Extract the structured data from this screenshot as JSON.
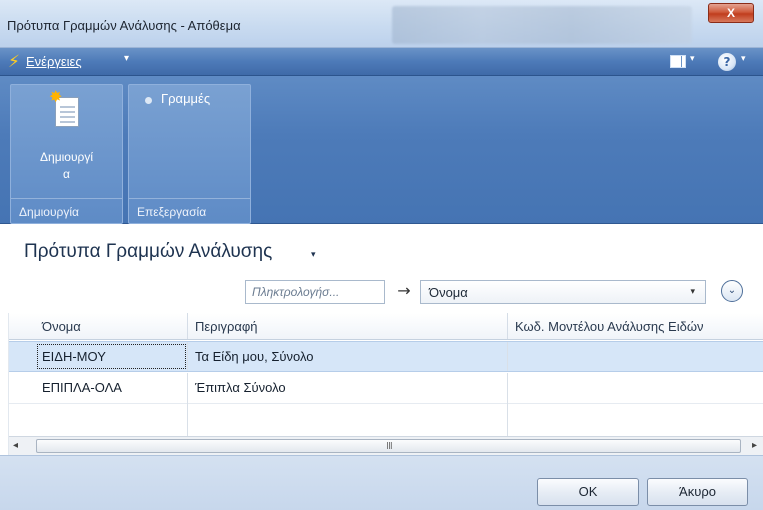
{
  "window": {
    "title": "Πρότυπα Γραμμών Ανάλυσης - Απόθεμα",
    "close_label": "X"
  },
  "actionbar": {
    "actions_label": "Ενέργειες",
    "actions_icon": "lightning-icon",
    "layout_icon": "layout-icon",
    "help_icon": "help-icon"
  },
  "ribbon": {
    "groups": [
      {
        "label": "Δημιουργία",
        "buttons": [
          {
            "label": "Δημιουργί α",
            "icon": "new-document-icon"
          }
        ]
      },
      {
        "label": "Επεξεργασία",
        "buttons": [
          {
            "label": "Γραμμές",
            "icon": "bullet-icon"
          }
        ]
      }
    ]
  },
  "page": {
    "title": "Πρότυπα Γραμμών Ανάλυσης"
  },
  "filter": {
    "search_placeholder": "Πληκτρολογήσ...",
    "field": "Όνομα"
  },
  "grid": {
    "columns": [
      "Όνομα",
      "Περιγραφή",
      "Κωδ. Μοντέλου Ανάλυσης Ειδών"
    ],
    "rows": [
      {
        "name": "ΕΙΔΗ-ΜΟΥ",
        "description": "Τα Είδη μου, Σύνολο",
        "code": ""
      },
      {
        "name": "ΕΠΙΠΛΑ-ΟΛΑ",
        "description": "Έπιπλα Σύνολο",
        "code": ""
      }
    ],
    "selected_row": 0
  },
  "footer": {
    "ok_label": "OK",
    "cancel_label": "Άκυρο"
  },
  "colors": {
    "accent": "#4d7ab8",
    "selection": "#d6e6f8",
    "close": "#c03d1e"
  }
}
